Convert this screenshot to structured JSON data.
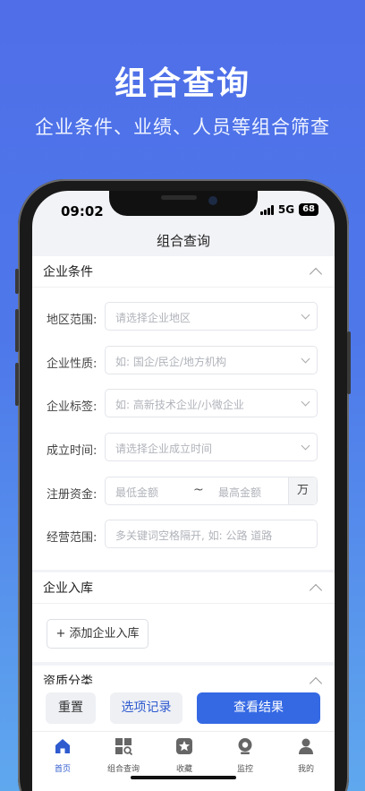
{
  "promo": {
    "title": "组合查询",
    "subtitle": "企业条件、业绩、人员等组合筛查"
  },
  "status": {
    "time": "09:02",
    "network": "5G",
    "battery": "68"
  },
  "nav": {
    "title": "组合查询"
  },
  "section_company": {
    "title": "企业条件",
    "fields": [
      {
        "label": "地区范围:",
        "placeholder": "请选择企业地区"
      },
      {
        "label": "企业性质:",
        "placeholder": "如: 国企/民企/地方机构"
      },
      {
        "label": "企业标签:",
        "placeholder": "如: 高新技术企业/小微企业"
      },
      {
        "label": "成立时间:",
        "placeholder": "请选择企业成立时间"
      },
      {
        "label": "注册资金:",
        "min_placeholder": "最低金额",
        "separator": "~",
        "max_placeholder": "最高金额",
        "unit": "万"
      },
      {
        "label": "经营范围:",
        "placeholder": "多关键词空格隔开, 如: 公路 道路"
      }
    ]
  },
  "section_warehouse": {
    "title": "企业入库",
    "add_label": "+ 添加企业入库"
  },
  "section_qualification": {
    "title": "资质分类"
  },
  "actions": {
    "reset": "重置",
    "records": "选项记录",
    "view": "查看结果"
  },
  "tabs": [
    {
      "label": "首页",
      "icon": "home-icon",
      "active": true
    },
    {
      "label": "组合查询",
      "icon": "grid-search-icon",
      "active": false
    },
    {
      "label": "收藏",
      "icon": "star-icon",
      "active": false
    },
    {
      "label": "监控",
      "icon": "camera-icon",
      "active": false
    },
    {
      "label": "我的",
      "icon": "user-icon",
      "active": false
    }
  ],
  "colors": {
    "accent": "#3569e4",
    "bg_top": "#4f6ee8",
    "bg_bottom": "#5fa8ee"
  }
}
